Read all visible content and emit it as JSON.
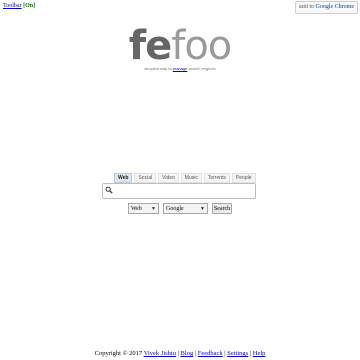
{
  "toolbar": {
    "link_label": "Toolbar",
    "status": "[On]"
  },
  "chrome_button": {
    "prefix": "add to",
    "label": "Google Chrome"
  },
  "logo": {
    "part1": "fe",
    "part2": "foo"
  },
  "tagline": {
    "before": "simplest way to",
    "highlight": "manage",
    "after": "search engines"
  },
  "tabs": [
    "Web",
    "Social",
    "Video",
    "Music",
    "Torrents",
    "People"
  ],
  "search": {
    "value": "",
    "placeholder": ""
  },
  "type_select": {
    "selected": "Web"
  },
  "engine_select": {
    "selected": "Google"
  },
  "search_button": {
    "label": "Search"
  },
  "footer": {
    "copyright": "Copyright © 2017",
    "links": [
      "Vivek Jishtu",
      "Blog",
      "Feedback",
      "Settings",
      "Help"
    ],
    "separator": " | "
  },
  "colors": {
    "link": "#0000cc",
    "status_on": "#008000",
    "logo_fe": "#666666",
    "logo_foo": "#9a9a9a"
  }
}
